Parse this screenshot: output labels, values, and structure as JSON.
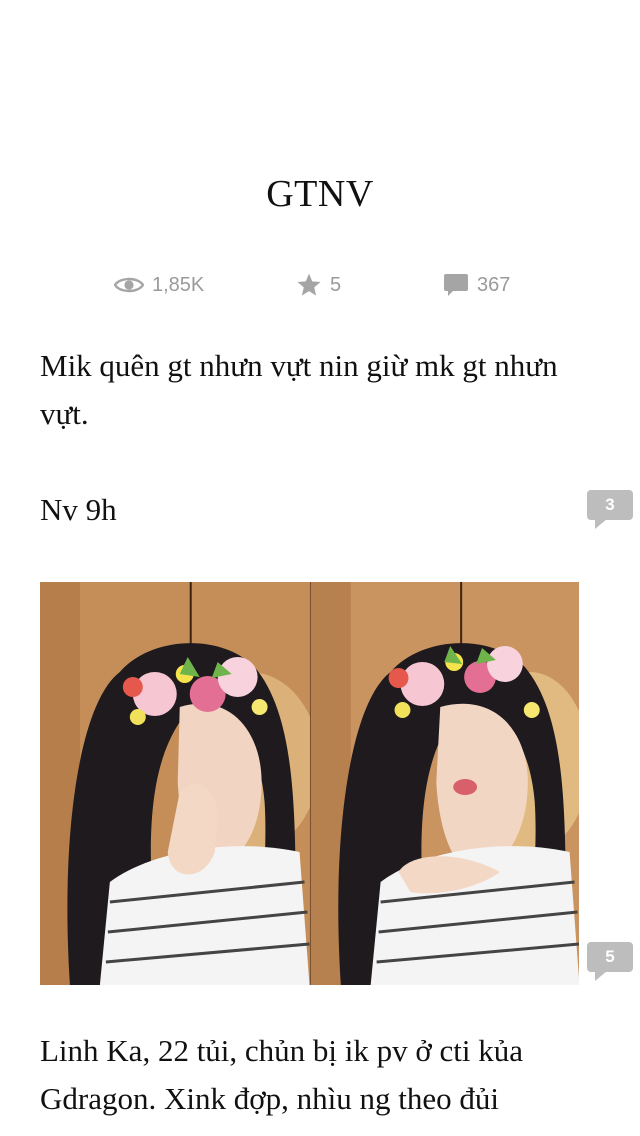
{
  "story": {
    "title": "GTNV",
    "stats": {
      "views": "1,85K",
      "votes": "5",
      "comments": "367"
    },
    "icons": {
      "views": "eye-icon",
      "votes": "star-icon",
      "comments": "comment-icon"
    },
    "paragraphs": [
      "Mik quên gt nhưn vựt nin giừ mk gt nhưn vựt.",
      "Nv 9h",
      "Linh Ka, 22 tủi, chủn bị ik pv ở cti kủa Gdragon. Xink đợp, nhìu ng theo đủi"
    ],
    "inline_comment_counts": [
      "3",
      "5"
    ],
    "image": {
      "description_icon": "photo-collage"
    }
  },
  "colors": {
    "muted_text": "#9a9a9a",
    "bubble": "#bdbdbd",
    "body_text": "#111111"
  }
}
